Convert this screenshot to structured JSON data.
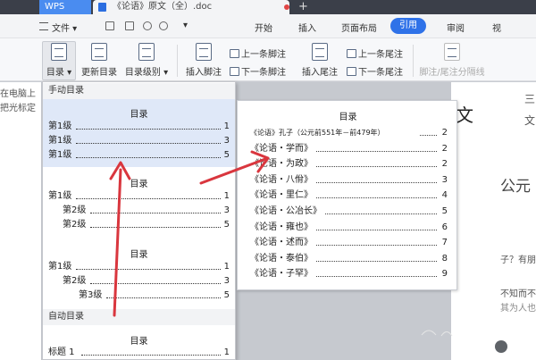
{
  "titlebar": {
    "app_tab": "WPS",
    "doc_tab": "《论语》原文（全）.doc",
    "doc_close": "×",
    "new_tab": "+"
  },
  "menubar": {
    "file": "文件",
    "tabs": [
      "开始",
      "插入",
      "页面布局",
      "引用",
      "审阅",
      "视"
    ],
    "active_tab": "引用",
    "accent_color": "#2f72e8"
  },
  "ribbon": {
    "toc": "目录",
    "update_toc": "更新目录",
    "toc_level": "目录级别",
    "insert_footnote": "插入脚注",
    "prev_footnote": "上一条脚注",
    "next_footnote": "下一条脚注",
    "insert_endnote": "插入尾注",
    "prev_endnote": "上一条尾注",
    "next_endnote": "下一条尾注",
    "divider": "脚注/尾注分隔线"
  },
  "dropdown": {
    "manual_header": "手动目录",
    "auto_header": "自动目录",
    "blocks": [
      {
        "title": "目录",
        "lines": [
          {
            "label": "第1级",
            "page": "1"
          },
          {
            "label": "第1级",
            "page": "3"
          },
          {
            "label": "第1级",
            "page": "5"
          }
        ]
      },
      {
        "title": "目录",
        "lines": [
          {
            "label": "第1级",
            "page": "1"
          },
          {
            "label": "第2级",
            "page": "3"
          },
          {
            "label": "第2级",
            "page": "5"
          }
        ]
      },
      {
        "title": "目录",
        "lines": [
          {
            "label": "第1级",
            "page": "1"
          },
          {
            "label": "第2级",
            "page": "3"
          },
          {
            "label": "第3级",
            "page": "5"
          }
        ]
      },
      {
        "title": "目录",
        "lines": [
          {
            "label": "标题 1",
            "page": "1"
          }
        ]
      }
    ]
  },
  "preview": {
    "title": "目录",
    "lines": [
      {
        "label": "《论语》孔子（公元前551年－前479年）",
        "page": "2"
      },
      {
        "label": "《论语・学而》",
        "page": "2"
      },
      {
        "label": "《论语・为政》",
        "page": "2"
      },
      {
        "label": "《论语・八佾》",
        "page": "3"
      },
      {
        "label": "《论语・里仁》",
        "page": "4"
      },
      {
        "label": "《论语・公冶长》",
        "page": "5"
      },
      {
        "label": "《论语・雍也》",
        "page": "6"
      },
      {
        "label": "《论语・述而》",
        "page": "7"
      },
      {
        "label": "《论语・泰伯》",
        "page": "8"
      },
      {
        "label": "《论语・子罕》",
        "page": "9"
      }
    ]
  },
  "background_fragments": {
    "left_1": "在电脑上",
    "left_2": "把光标定",
    "right_1": "文",
    "right_2": "三",
    "right_3": "文",
    "right_4": "公元",
    "right_5": "子？有朋",
    "right_6": "不知而不",
    "right_7": "其为人也"
  },
  "colors": {
    "arrow": "#d9363e",
    "selected_block": "#dfe8f8"
  }
}
